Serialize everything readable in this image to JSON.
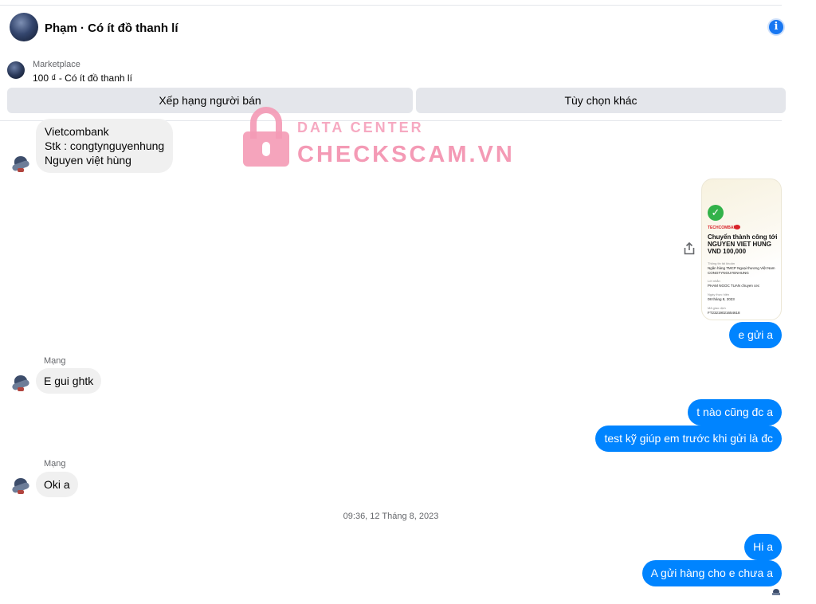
{
  "header": {
    "title": "Phạm · Có ít đồ thanh lí",
    "info_icon": "i"
  },
  "marketplace": {
    "label": "Marketplace",
    "item": "100 ₫ - Có ít đồ thanh lí"
  },
  "actions": {
    "rate_seller": "Xếp hạng người bán",
    "more_options": "Tùy chọn khác"
  },
  "watermark": {
    "small": "DATA CENTER",
    "big": "CHECKSCAM.VN"
  },
  "messages": {
    "bank_lines": [
      "Vietcombank",
      "Stk : congtynguyenhung",
      "Nguyen việt hùng"
    ],
    "receipt": {
      "bank": "TECHCOMBANK",
      "title": "Chuyển thành công tới NGUYEN VIET HUNG VND 100,000",
      "label1": "Thông tin tài khoản",
      "value1": "Ngân hàng TMCP Ngoại thương Việt Nam CONGTYNGUYENHUNG",
      "label2": "Lời nhắn",
      "value2": "PHAM NGOC TUAN chuyen cec",
      "label3": "Ngày thực hiện",
      "value3": "08 tháng 8, 2023",
      "label4": "Mã giao dịch",
      "value4": "FT23219021654618"
    },
    "sent_receipt": "e gửi a",
    "sender_name_1": "Mạng",
    "in_1": "E gui ghtk",
    "out_1": "t nào cũng đc a",
    "out_2": "test kỹ giúp em trước khi gửi là đc",
    "sender_name_2": "Mạng",
    "in_2": "Oki a",
    "timestamp": "09:36, 12 Tháng 8, 2023",
    "out_3": "Hi a",
    "out_4": "A gửi hàng cho e chưa a"
  },
  "colors": {
    "outgoing": "#0084ff",
    "incoming": "#f0f0f0",
    "watermark": "#f49ab5"
  }
}
